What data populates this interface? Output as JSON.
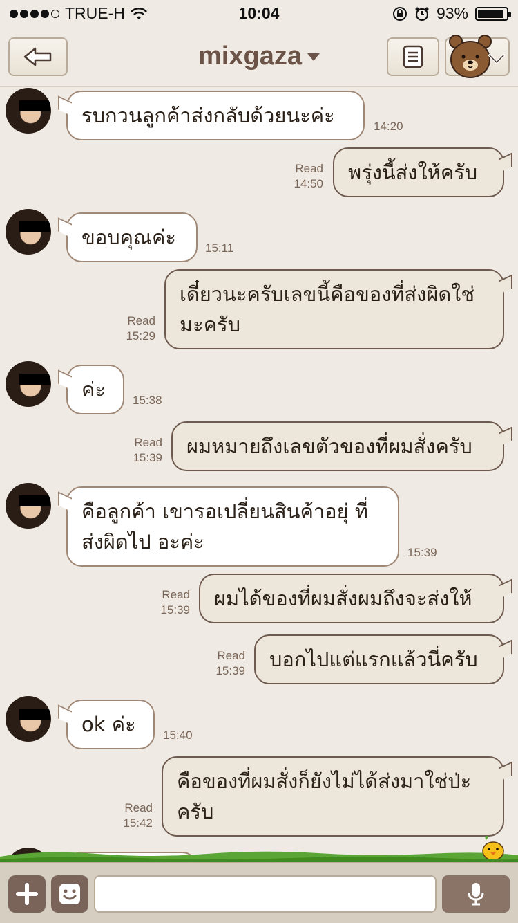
{
  "status_bar": {
    "carrier": "TRUE-H",
    "time": "10:04",
    "battery": "93%",
    "battery_level": 0.93
  },
  "header": {
    "title": "mixgaza"
  },
  "messages": [
    {
      "direction": "in",
      "text": "รบกวนลูกค้าส่งกลับด้วยนะค่ะ",
      "time": "14:20"
    },
    {
      "direction": "out",
      "text": "พรุ่งนี้ส่งให้ครับ",
      "time": "14:50",
      "status": "Read"
    },
    {
      "direction": "in",
      "text": "ขอบคุณค่ะ",
      "time": "15:11"
    },
    {
      "direction": "out",
      "text": "เดี๋ยวนะครับเลขนี้คือของที่ส่งผิดใช่มะครับ",
      "time": "15:29",
      "status": "Read"
    },
    {
      "direction": "in",
      "text": "ค่ะ",
      "time": "15:38"
    },
    {
      "direction": "out",
      "text": "ผมหมายถึงเลขตัวของที่ผมสั่งครับ",
      "time": "15:39",
      "status": "Read"
    },
    {
      "direction": "in",
      "text": "คือลูกค้า เขารอเปลี่ยนสินค้าอยุ่ ที่ส่งผิดไป อะค่ะ",
      "time": "15:39"
    },
    {
      "direction": "out",
      "text": "ผมได้ของที่ผมสั่งผมถึงจะส่งให้",
      "time": "15:39",
      "status": "Read"
    },
    {
      "direction": "out",
      "text": "บอกไปแต่แรกแล้วนี่ครับ",
      "time": "15:39",
      "status": "Read"
    },
    {
      "direction": "in",
      "text": "ok ค่ะ",
      "time": "15:40"
    },
    {
      "direction": "out",
      "text": "คือของที่ผมสั่งก็ยังไม่ได้ส่งมาใช่ป่ะครับ",
      "time": "15:42",
      "status": "Read"
    }
  ],
  "composer": {
    "placeholder": ""
  },
  "colors": {
    "background": "#efebe4",
    "bubble_in": "#ffffff",
    "bubble_out": "#ede6da",
    "accent_brown": "#6b5347"
  }
}
